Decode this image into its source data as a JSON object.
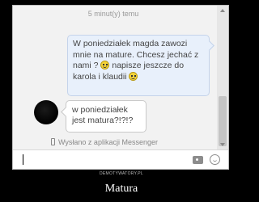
{
  "chat": {
    "timestamp": "5 minut(y) temu",
    "outgoing_message": {
      "text_1": "W poniedziałek magda zawozi mnie na mature. Chcesz jechać z nami ?",
      "text_2": "napisze jeszcze do karola i klaudii"
    },
    "incoming_message": {
      "text": "w poniedziałek jest matura?!?!?"
    },
    "sent_from": "Wysłano z aplikacji Messenger"
  },
  "composer": {
    "input_value": ""
  },
  "poster": {
    "watermark": "DEMOTYWATORY.PL",
    "caption": "Matura"
  }
}
